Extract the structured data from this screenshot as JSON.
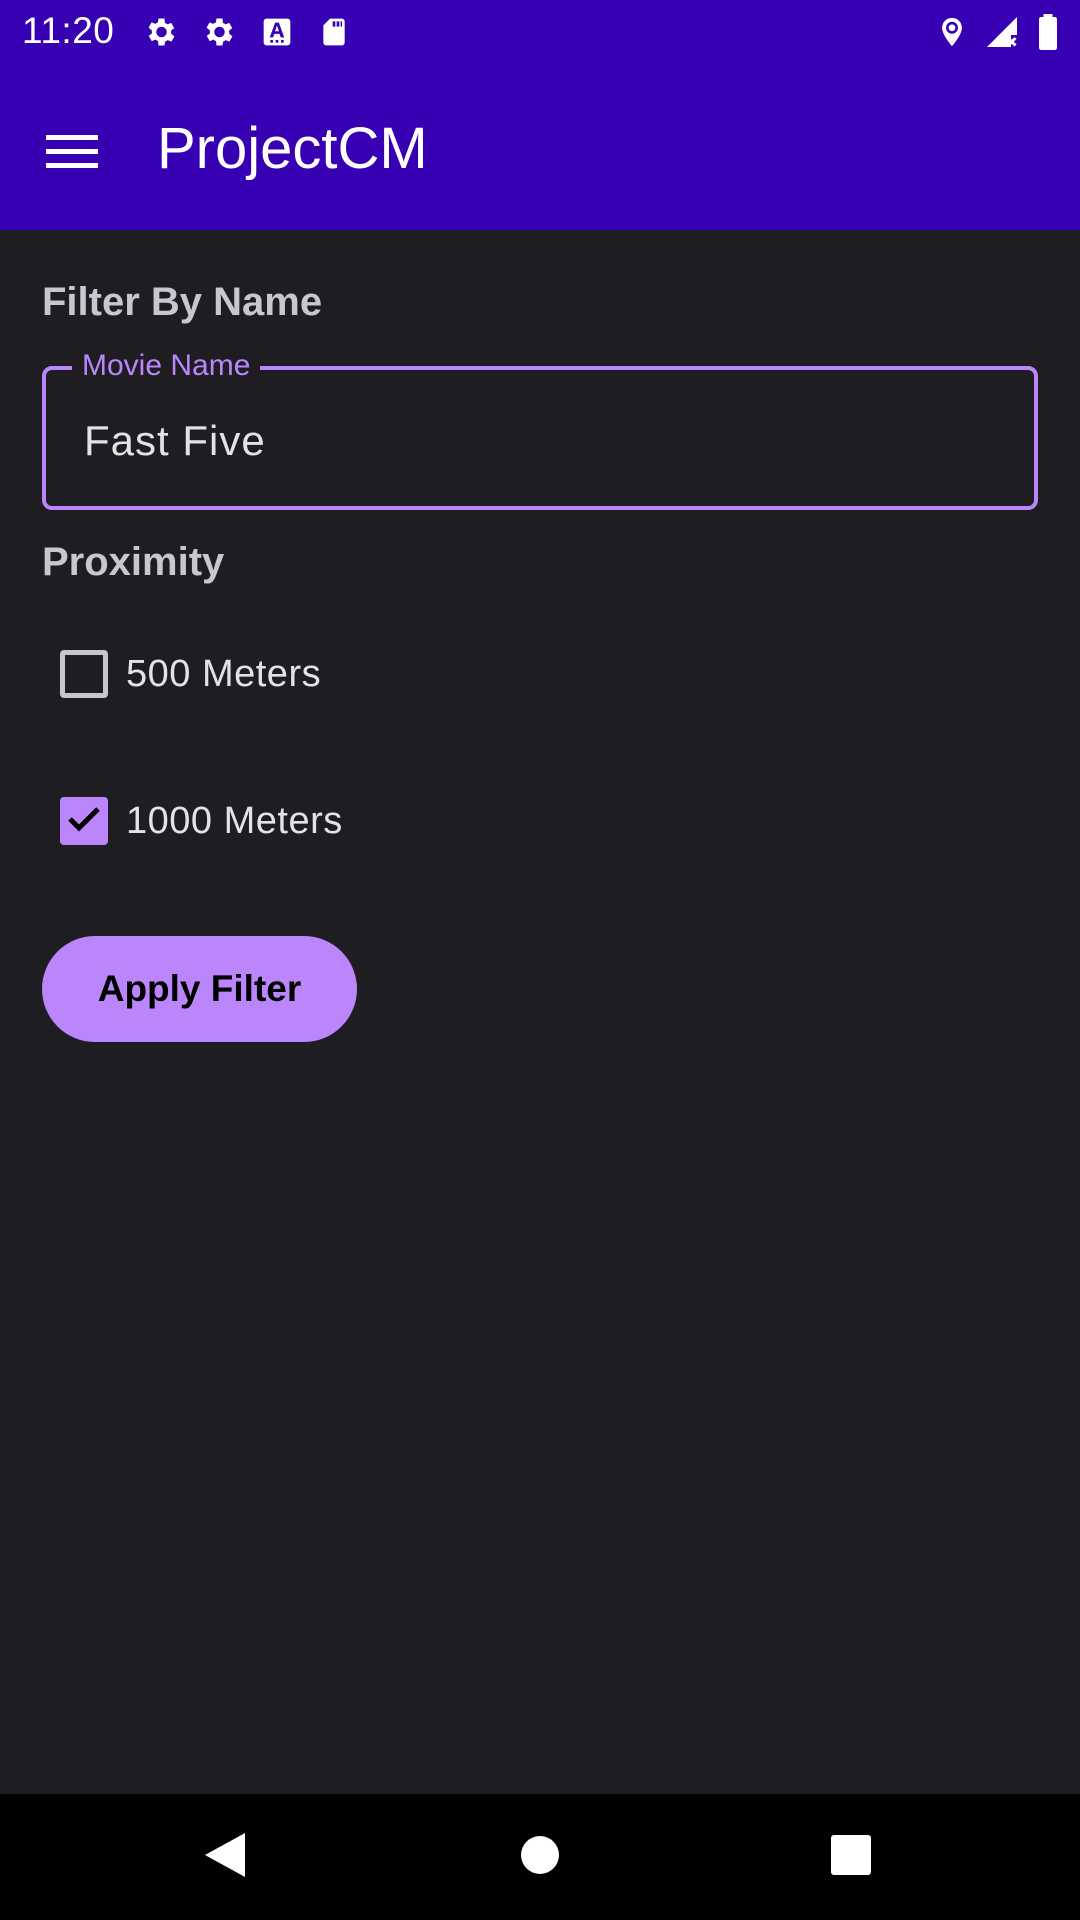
{
  "status_bar": {
    "time": "11:20",
    "left_icons": [
      "settings-icon",
      "settings-icon",
      "keyboard-a-icon",
      "sd-card-icon"
    ],
    "right_icons": [
      "location-icon",
      "signal-icon",
      "battery-icon"
    ]
  },
  "app_bar": {
    "title": "ProjectCM",
    "menu_icon": "menu-icon",
    "background": "#3700b3"
  },
  "filter_by_name": {
    "heading": "Filter By Name",
    "field_label": "Movie Name",
    "field_value": "Fast Five"
  },
  "proximity": {
    "heading": "Proximity",
    "options": [
      {
        "label": "500 Meters",
        "checked": false
      },
      {
        "label": "1000 Meters",
        "checked": true
      }
    ]
  },
  "apply_button": {
    "label": "Apply Filter"
  },
  "colors": {
    "accent": "#bb86fc",
    "background": "#1e1d22",
    "primary": "#3700b3"
  },
  "nav_bar": {
    "icons": [
      "back-icon",
      "home-icon",
      "recents-icon"
    ]
  }
}
